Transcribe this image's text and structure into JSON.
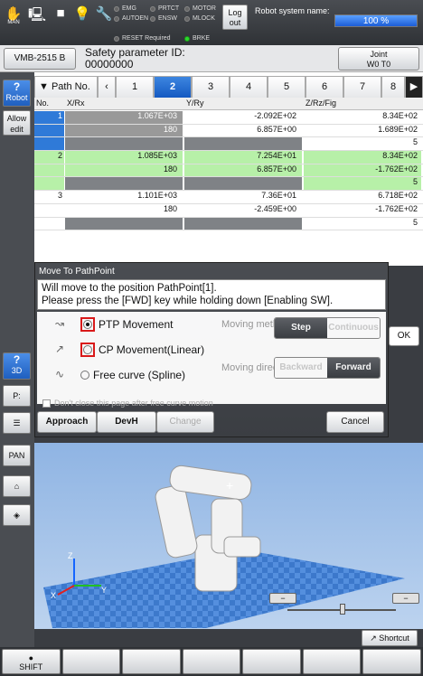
{
  "topbar": {
    "mode_label": "MAN",
    "indicators": {
      "emg": "EMG",
      "prtct": "PRTCT",
      "motor": "MOTOR",
      "autoen": "AUTOEN",
      "ensw": "ENSW",
      "mlock": "MLOCK",
      "reset_required": "RESET Required",
      "brke": "BRKE"
    },
    "logout_label": "Log out",
    "system_name_label": "Robot system name:",
    "speed_percent": 100,
    "speed_text": "100 %"
  },
  "header": {
    "robot_model": "VMB-2515 B",
    "safety_param_label": "Safety parameter ID:",
    "safety_param_id": "00000000",
    "joint_label": "Joint",
    "joint_sub": "W0 T0"
  },
  "leftbar": {
    "robot_label": "Robot",
    "allow_edit_label": "Allow edit",
    "btn_3d_label": "3D",
    "pan_label": "PAN"
  },
  "path_table": {
    "path_label": "Path No.",
    "tabs": [
      "1",
      "2",
      "3",
      "4",
      "5",
      "6",
      "7",
      "8"
    ],
    "active_tab": "2",
    "columns": [
      "No.",
      "X/Rx",
      "Y/Ry",
      "Z/Rz/Fig"
    ],
    "rows": [
      {
        "no": "1",
        "x": "1.067E+03",
        "y": "-2.092E+02",
        "z": "8.34E+02"
      },
      {
        "no": "",
        "x": "180",
        "y": "6.857E+00",
        "z": "1.689E+02"
      },
      {
        "no": "",
        "x": "",
        "y": "",
        "z": "5"
      },
      {
        "no": "2",
        "x": "1.085E+03",
        "y": "7.254E+01",
        "z": "8.34E+02"
      },
      {
        "no": "",
        "x": "180",
        "y": "6.857E+00",
        "z": "-1.762E+02"
      },
      {
        "no": "",
        "x": "",
        "y": "",
        "z": "5"
      },
      {
        "no": "3",
        "x": "1.101E+03",
        "y": "7.36E+01",
        "z": "6.718E+02"
      },
      {
        "no": "",
        "x": "180",
        "y": "-2.459E+00",
        "z": "-1.762E+02"
      },
      {
        "no": "",
        "x": "",
        "y": "",
        "z": "5"
      }
    ]
  },
  "dialog": {
    "title": "Move To PathPoint",
    "message_line1": "Will move to the position PathPoint[1].",
    "message_line2": "Please press the [FWD] key while holding down [Enabling SW].",
    "options": {
      "ptp": "PTP Movement",
      "cp": "CP Movement(Linear)",
      "spline": "Free curve (Spline)"
    },
    "moving_method_label": "Moving method",
    "method_step": "Step",
    "method_continuous": "Continuous",
    "moving_direction_label": "Moving direction",
    "dir_backward": "Backward",
    "dir_forward": "Forward",
    "dont_close_label": "Don't close this page after free curve motion",
    "approach_label": "Approach",
    "devh_label": "DevH",
    "change_label": "Change",
    "cancel_label": "Cancel"
  },
  "ok_label": "OK",
  "axes": {
    "x": "X",
    "y": "Y",
    "z": "Z"
  },
  "bottom": {
    "shortcut_label": "Shortcut",
    "shift_label": "SHIFT"
  }
}
